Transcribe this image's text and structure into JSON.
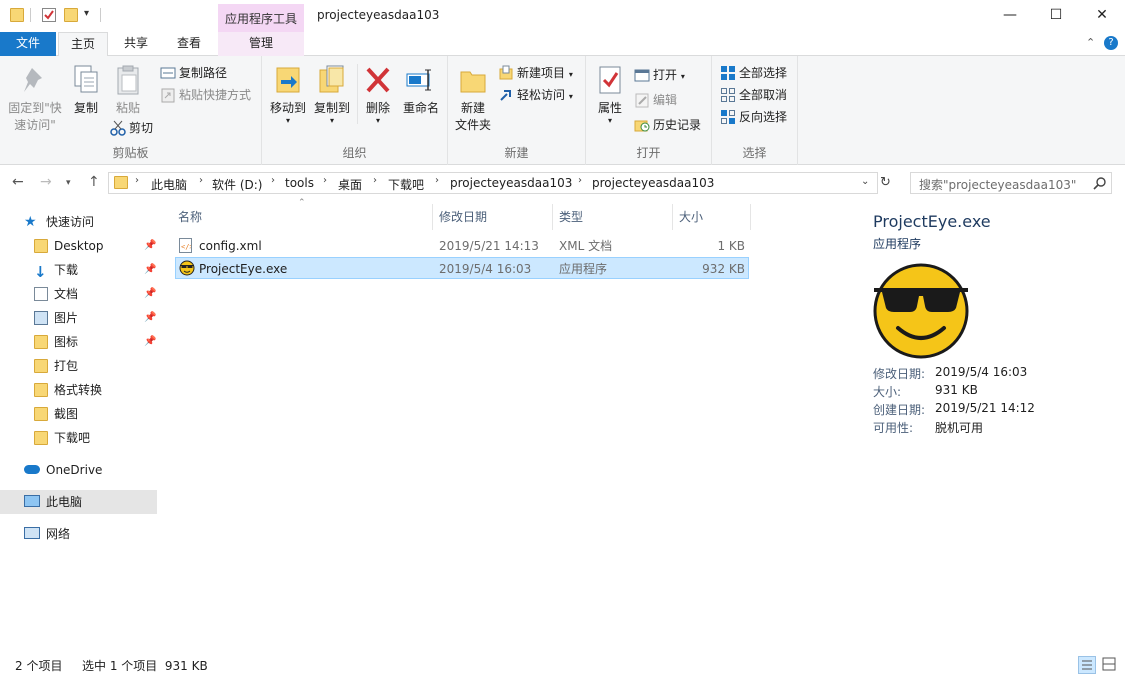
{
  "title_bar": {
    "context_tab_header": "应用程序工具",
    "window_title": "projecteyeasdaa103",
    "minimize": "—",
    "maximize": "☐",
    "close": "✕"
  },
  "tabs": {
    "file": "文件",
    "home": "主页",
    "share": "共享",
    "view": "查看",
    "manage": "管理"
  },
  "ribbon": {
    "clipboard": {
      "title": "剪贴板",
      "pin_label_1": "固定到\"快",
      "pin_label_2": "速访问\"",
      "copy": "复制",
      "paste": "粘贴",
      "copy_path": "复制路径",
      "paste_shortcut": "粘贴快捷方式",
      "cut": "剪切"
    },
    "organize": {
      "title": "组织",
      "move_to": "移动到",
      "copy_to": "复制到",
      "delete": "删除",
      "rename": "重命名"
    },
    "new": {
      "title": "新建",
      "new_folder_1": "新建",
      "new_folder_2": "文件夹",
      "new_item": "新建项目",
      "easy_access": "轻松访问"
    },
    "open": {
      "title": "打开",
      "properties": "属性",
      "open": "打开",
      "edit": "编辑",
      "history": "历史记录"
    },
    "select": {
      "title": "选择",
      "select_all": "全部选择",
      "select_none": "全部取消",
      "invert": "反向选择"
    }
  },
  "address": {
    "crumbs": [
      "此电脑",
      "软件 (D:)",
      "tools",
      "桌面",
      "下载吧",
      "projecteyeasdaa103",
      "projecteyeasdaa103"
    ],
    "search_placeholder": "搜索\"projecteyeasdaa103\""
  },
  "nav_pane": {
    "quick_access": "快速访问",
    "items": [
      {
        "label": "Desktop",
        "pinned": true
      },
      {
        "label": "下载",
        "pinned": true
      },
      {
        "label": "文档",
        "pinned": true
      },
      {
        "label": "图片",
        "pinned": true
      },
      {
        "label": "图标",
        "pinned": true
      },
      {
        "label": "打包",
        "pinned": false
      },
      {
        "label": "格式转换",
        "pinned": false
      },
      {
        "label": "截图",
        "pinned": false
      },
      {
        "label": "下载吧",
        "pinned": false
      }
    ],
    "onedrive": "OneDrive",
    "this_pc": "此电脑",
    "network": "网络"
  },
  "file_list": {
    "columns": {
      "name": "名称",
      "modified": "修改日期",
      "type": "类型",
      "size": "大小"
    },
    "rows": [
      {
        "name": "config.xml",
        "modified": "2019/5/21 14:13",
        "type": "XML 文档",
        "size": "1 KB",
        "selected": false
      },
      {
        "name": "ProjectEye.exe",
        "modified": "2019/5/4 16:03",
        "type": "应用程序",
        "size": "932 KB",
        "selected": true
      }
    ]
  },
  "details": {
    "file_name": "ProjectEye.exe",
    "file_type": "应用程序",
    "modified_label": "修改日期:",
    "modified_value": "2019/5/4 16:03",
    "size_label": "大小:",
    "size_value": "931 KB",
    "created_label": "创建日期:",
    "created_value": "2019/5/21 14:12",
    "availability_label": "可用性:",
    "availability_value": "脱机可用"
  },
  "status_bar": {
    "item_count": "2 个项目",
    "selection": "选中 1 个项目  931 KB"
  },
  "colors": {
    "accent": "#1979ca",
    "selection": "#cce8ff",
    "context_tab": "#f4d7f4"
  }
}
